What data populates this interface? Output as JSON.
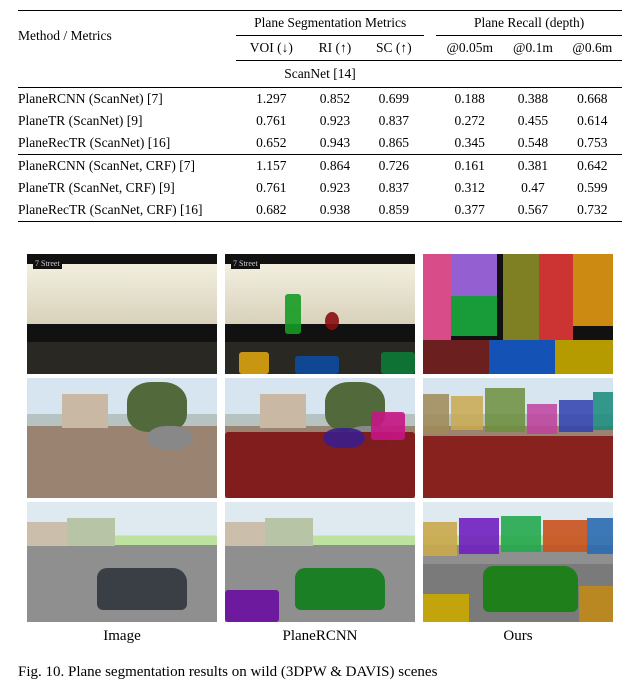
{
  "table": {
    "head": {
      "method_metrics": "Method / Metrics",
      "seg_group": "Plane Segmentation Metrics",
      "recall_group": "Plane Recall (depth)",
      "cols": {
        "voi": "VOI (↓)",
        "ri": "RI (↑)",
        "sc": "SC (↑)",
        "r005": "@0.05m",
        "r01": "@0.1m",
        "r06": "@0.6m"
      }
    },
    "section_label": "ScanNet [14]",
    "groups": [
      [
        {
          "method": "PlaneRCNN (ScanNet) [7]",
          "voi": "1.297",
          "ri": "0.852",
          "sc": "0.699",
          "r005": "0.188",
          "r01": "0.388",
          "r06": "0.668"
        },
        {
          "method": "PlaneTR (ScanNet) [9]",
          "voi": "0.761",
          "ri": "0.923",
          "sc": "0.837",
          "r005": "0.272",
          "r01": "0.455",
          "r06": "0.614"
        },
        {
          "method": "PlaneRecTR (ScanNet) [16]",
          "voi": "0.652",
          "ri": "0.943",
          "sc": "0.865",
          "r005": "0.345",
          "r01": "0.548",
          "r06": "0.753"
        }
      ],
      [
        {
          "method": "PlaneRCNN (ScanNet, CRF) [7]",
          "voi": "1.157",
          "ri": "0.864",
          "sc": "0.726",
          "r005": "0.161",
          "r01": "0.381",
          "r06": "0.642"
        },
        {
          "method": "PlaneTR (ScanNet, CRF) [9]",
          "voi": "0.761",
          "ri": "0.923",
          "sc": "0.837",
          "r005": "0.312",
          "r01": "0.47",
          "r06": "0.599"
        },
        {
          "method": "PlaneRecTR (ScanNet, CRF) [16]",
          "voi": "0.682",
          "ri": "0.938",
          "sc": "0.859",
          "r005": "0.377",
          "r01": "0.567",
          "r06": "0.732"
        }
      ]
    ]
  },
  "figure": {
    "columns": [
      "Image",
      "PlaneRCNN",
      "Ours"
    ],
    "subway_tag": "7 Street",
    "caption": "Fig. 10.   Plane segmentation results on wild (3DPW & DAVIS) scenes"
  }
}
